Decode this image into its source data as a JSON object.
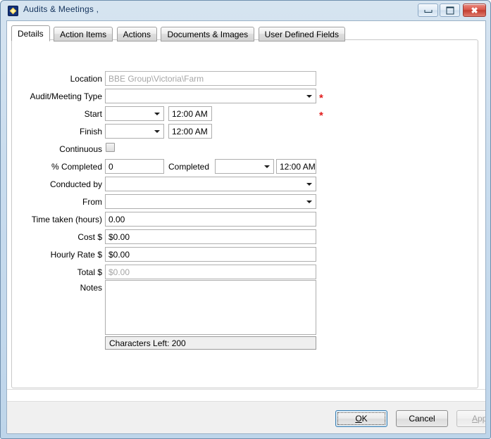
{
  "window": {
    "title": "Audits & Meetings ,",
    "icon": "diamond-app-icon",
    "controls": {
      "minimize": "Minimize",
      "maximize": "Maximize",
      "close": "Close"
    }
  },
  "tabs": [
    {
      "label": "Details",
      "active": true
    },
    {
      "label": "Action Items",
      "active": false
    },
    {
      "label": "Actions",
      "active": false
    },
    {
      "label": "Documents & Images",
      "active": false
    },
    {
      "label": "User Defined Fields",
      "active": false
    }
  ],
  "form": {
    "location": {
      "label": "Location",
      "value": "BBE Group\\Victoria\\Farm",
      "state": "readonly"
    },
    "audit_meeting_type": {
      "label": "Audit/Meeting Type",
      "value": "",
      "required": true,
      "required_marker": "*"
    },
    "start": {
      "label": "Start",
      "date_value": "",
      "time_value": "12:00 AM",
      "required": true,
      "required_marker": "*"
    },
    "finish": {
      "label": "Finish",
      "date_value": "",
      "time_value": "12:00 AM"
    },
    "continuous": {
      "label": "Continuous",
      "checked": false
    },
    "percent_completed": {
      "label": "% Completed",
      "value": "0"
    },
    "completed": {
      "label": "Completed",
      "date_value": "",
      "time_value": "12:00 AM"
    },
    "conducted_by": {
      "label": "Conducted by",
      "value": ""
    },
    "from": {
      "label": "From",
      "value": ""
    },
    "time_taken": {
      "label": "Time taken (hours)",
      "value": "0.00"
    },
    "cost": {
      "label": "Cost $",
      "value": "$0.00"
    },
    "hourly_rate": {
      "label": "Hourly Rate $",
      "value": "$0.00"
    },
    "total": {
      "label": "Total $",
      "value": "$0.00",
      "state": "disabled"
    },
    "notes": {
      "label": "Notes",
      "value": "",
      "characters_left": "Characters Left: 200"
    }
  },
  "footer": {
    "ok": {
      "label": "OK",
      "accelerator": "O",
      "focused": true
    },
    "cancel": {
      "label": "Cancel"
    },
    "apply": {
      "label": "Apply",
      "accelerator": "A",
      "disabled": true
    }
  },
  "colors": {
    "required_asterisk": "#e21d1d",
    "titlebar_text": "#14335c",
    "frame": "#bed5ea",
    "close_button": "#c23d30",
    "focus_border": "#3c7fb1"
  }
}
